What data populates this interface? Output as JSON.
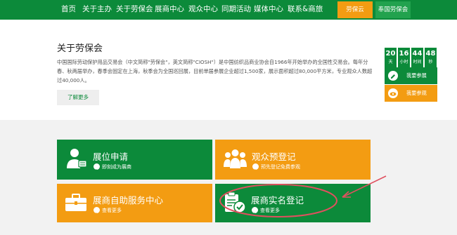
{
  "nav": {
    "items": [
      "首页",
      "关于主办",
      "关于劳保会",
      "展商中心",
      "观众中心",
      "同期活动",
      "媒体中心",
      "联系&商旅"
    ],
    "pill_orange": "劳保云",
    "pill_green": "奉国劳保会"
  },
  "about": {
    "title": "关于劳保会",
    "text": "中国国际劳动保护用品交易会（中文简称\"劳保会\"，英文简称\"CIOSH\"）是中国纺织品商业协会自1966年开始举办的全国性交易会。每年分春、秋两届举办，春季会固定在上海，秋季会为全国巡回展，目前单届参展企业超过1,500家，展示面积超过80,000平方米，专业观众人数超过40,000人。",
    "more": "了解更多"
  },
  "countdown": [
    {
      "num": "20",
      "unit": "天"
    },
    {
      "num": "16",
      "unit": "小时"
    },
    {
      "num": "44",
      "unit": "时间"
    },
    {
      "num": "48",
      "unit": "秒"
    }
  ],
  "side": {
    "exhibit": "我要参展",
    "visit": "我要参观"
  },
  "cards": {
    "booth": {
      "title": "展位申请",
      "sub": "即刻成为展商"
    },
    "preregister": {
      "title": "观众预登记",
      "sub": "预先登记免费参观"
    },
    "self_service": {
      "title": "展商自助服务中心",
      "sub": "查看更多"
    },
    "realname": {
      "title": "展商实名登记",
      "sub": "查看更多"
    }
  },
  "colors": {
    "green": "#0c8a3a",
    "orange": "#f39c12",
    "annotation_red": "#e0505f"
  }
}
